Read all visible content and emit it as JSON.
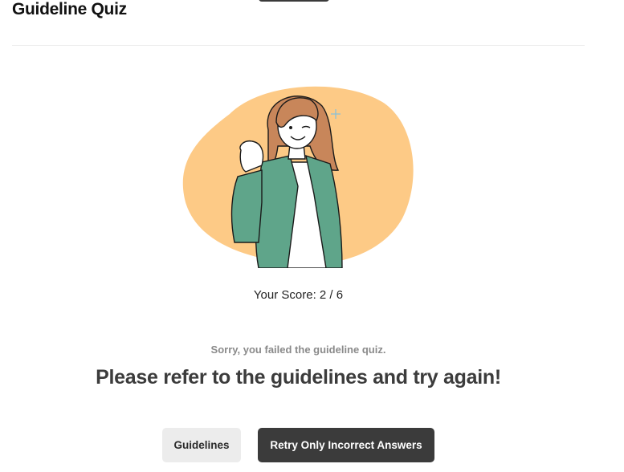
{
  "header": {
    "title": "Guideline Quiz"
  },
  "result": {
    "score_label": "Your Score: 2 / 6",
    "score": 2,
    "total": 6,
    "status_message": "Sorry, you failed the guideline quiz.",
    "headline": "Please refer to the guidelines and try again!"
  },
  "actions": {
    "guidelines_label": "Guidelines",
    "retry_label": "Retry Only Incorrect Answers"
  },
  "illustration": {
    "subject": "woman-thumbs-up-wink",
    "blob_color": "#fdca86",
    "jacket_color": "#5fa58a",
    "hair_color": "#c8865a"
  },
  "colors": {
    "primary_button": "#3b3b3b",
    "secondary_button": "#ececec"
  }
}
